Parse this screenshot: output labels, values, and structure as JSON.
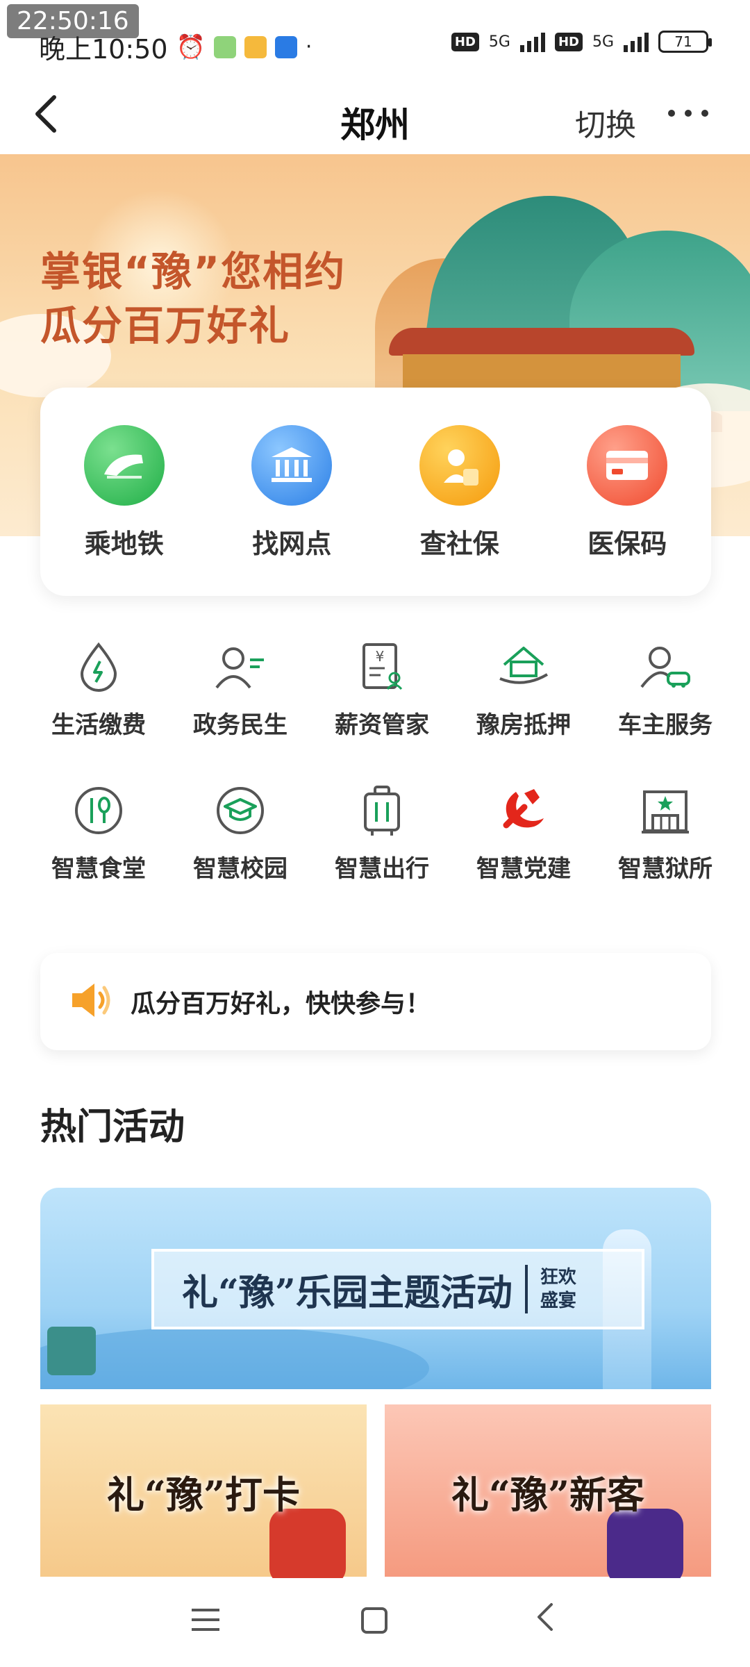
{
  "status_bar": {
    "overlay_time": "22:50:16",
    "time": "晚上10:50",
    "net1": "5G",
    "net2": "5G",
    "hd1": "HD",
    "hd2": "HD",
    "battery": "71"
  },
  "nav": {
    "title": "郑州",
    "switch_label": "切换",
    "back_icon": "chevron-left-icon",
    "more_icon": "more-dots-icon"
  },
  "hero": {
    "line1": "掌银“豫”您相约",
    "line2": "瓜分百万好礼"
  },
  "quick_actions": [
    {
      "label": "乘地铁",
      "icon": "metro-icon"
    },
    {
      "label": "找网点",
      "icon": "bank-icon"
    },
    {
      "label": "查社保",
      "icon": "social-security-icon"
    },
    {
      "label": "医保码",
      "icon": "medical-card-icon"
    }
  ],
  "services": [
    {
      "label": "生活缴费",
      "icon": "utility-bill-icon"
    },
    {
      "label": "政务民生",
      "icon": "government-icon"
    },
    {
      "label": "薪资管家",
      "icon": "salary-icon"
    },
    {
      "label": "豫房抵押",
      "icon": "house-mortgage-icon"
    },
    {
      "label": "车主服务",
      "icon": "car-owner-icon"
    },
    {
      "label": "智慧食堂",
      "icon": "canteen-icon"
    },
    {
      "label": "智慧校园",
      "icon": "campus-icon"
    },
    {
      "label": "智慧出行",
      "icon": "luggage-icon"
    },
    {
      "label": "智慧党建",
      "icon": "party-emblem-icon"
    },
    {
      "label": "智慧狱所",
      "icon": "building-icon"
    }
  ],
  "notice": {
    "text": "瓜分百万好礼，快快参与！"
  },
  "section": {
    "title": "热门活动"
  },
  "banners": {
    "main_title": "礼“豫”乐园主题活动",
    "main_sub1": "狂欢",
    "main_sub2": "盛宴",
    "left_title": "礼“豫”打卡",
    "right_title": "礼“豫”新客"
  },
  "colors": {
    "accent_green": "#1aa05a",
    "hero_text": "#c4562b"
  }
}
